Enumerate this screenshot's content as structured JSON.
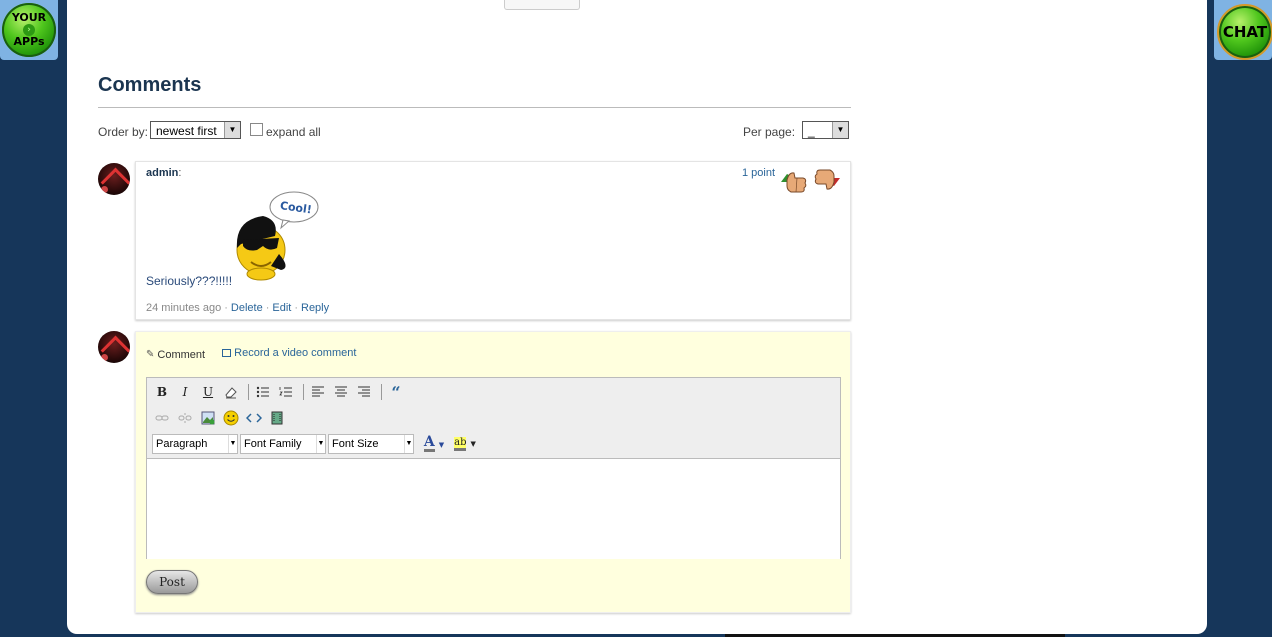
{
  "launcher": {
    "apps_line1": "YOUR",
    "apps_line2": "APPs",
    "chat_label": "CHAT"
  },
  "comments": {
    "title": "Comments",
    "order_label": "Order by:",
    "order_value": "newest first",
    "expand_label": "expand all",
    "perpage_label": "Per page:",
    "perpage_value": "_"
  },
  "comment": {
    "author": "admin",
    "author_suffix": ":",
    "points": "1 point",
    "smiley_bubble": "Cool!",
    "text": "Seriously???!!!!!",
    "time": "24 minutes ago",
    "actions": {
      "delete": "Delete",
      "edit": "Edit",
      "reply": "Reply"
    }
  },
  "reply_form": {
    "tab_comment": "Comment",
    "tab_video": "Record a video comment",
    "toolbar": {
      "bold": "B",
      "italic": "I",
      "underline": "U",
      "format_value": "Paragraph",
      "font_family_value": "Font Family",
      "font_size_value": "Font Size",
      "font_color_glyph": "A",
      "highlight_glyph": "ab"
    },
    "post_label": "Post"
  },
  "colors": {
    "background": "#16365a",
    "accent_link": "#2a6599",
    "reply_bg": "#ffffde"
  }
}
